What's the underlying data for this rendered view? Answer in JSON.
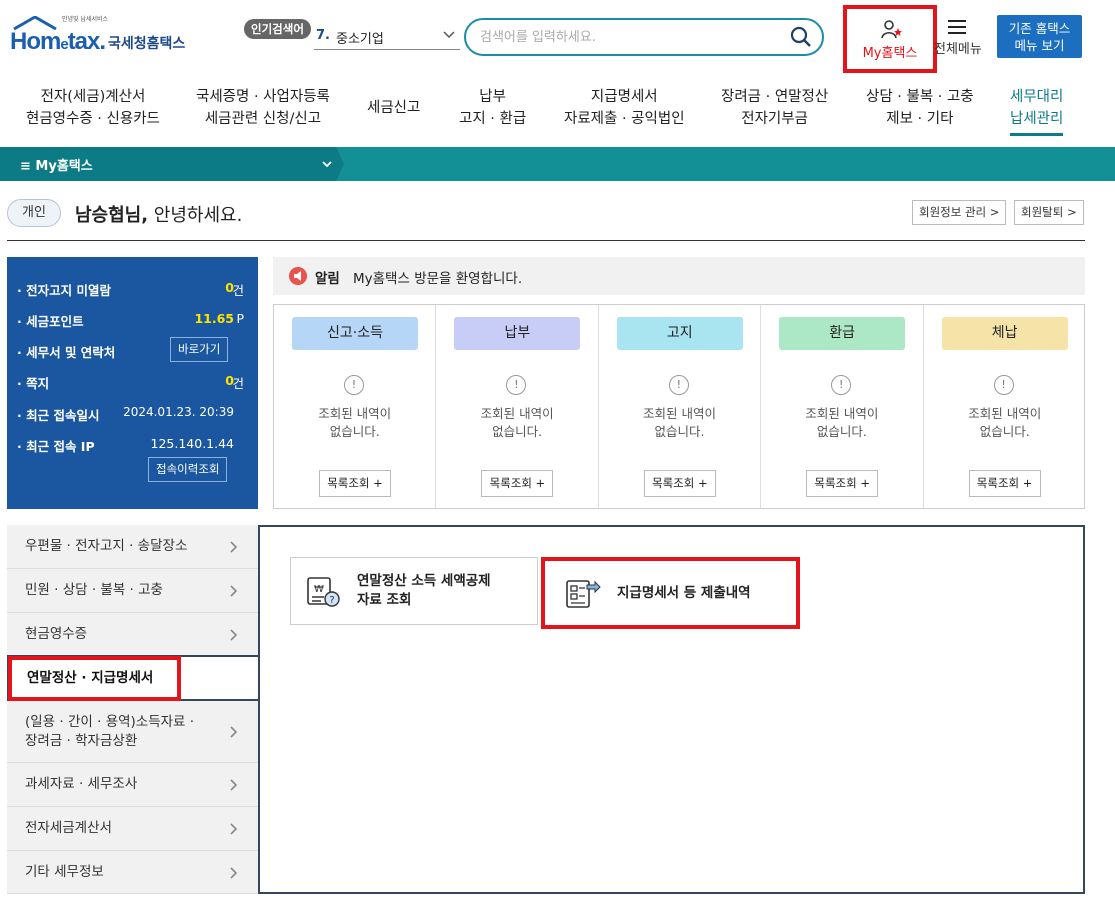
{
  "header": {
    "logo_tagline": "안녕및 납세서비스",
    "logo_home": "Hom",
    "logo_e": "e",
    "logo_tax": "tax.",
    "logo_agency": "국세청홈택스",
    "popular_badge": "인기검색어",
    "popular_num": "7.",
    "popular_keyword": "중소기업",
    "search_placeholder": "검색어를 입력하세요.",
    "myhome_label": "My홈택스",
    "allmenu_label": "전체메뉴",
    "old_menu_line1": "기존 홈택스",
    "old_menu_line2": "메뉴 보기"
  },
  "nav": [
    {
      "line1": "전자(세금)계산서",
      "line2": "현금영수증 · 신용카드"
    },
    {
      "line1": "국세증명 · 사업자등록",
      "line2": "세금관련 신청/신고"
    },
    {
      "line1": "세금신고",
      "line2": ""
    },
    {
      "line1": "납부",
      "line2": "고지 · 환급"
    },
    {
      "line1": "지급명세서",
      "line2": "자료제출 · 공익법인"
    },
    {
      "line1": "장려금 · 연말정산",
      "line2": "전자기부금"
    },
    {
      "line1": "상담 · 불복 · 고충",
      "line2": "제보 · 기타"
    },
    {
      "line1": "세무대리",
      "line2": "납세관리"
    }
  ],
  "subbar": {
    "label": "≡  My홈택스"
  },
  "greeting": {
    "type_badge": "개인",
    "name": "남승협님,",
    "text": " 안녕하세요.",
    "btn_member_info": "회원정보 관리 >",
    "btn_withdraw": "회원탈퇴 >"
  },
  "info": {
    "unread_label": "· 전자고지 미열람",
    "unread_value": "0",
    "unread_unit": "건",
    "points_label": "· 세금포인트",
    "points_value": "11.65",
    "points_unit": "P",
    "office_label": "· 세무서 및 연락처",
    "office_btn": "바로가기",
    "note_label": "· 쪽지",
    "note_value": "0",
    "note_unit": "건",
    "last_login_label": "· 최근 접속일시",
    "last_login_value": "2024.01.23.  20:39",
    "last_ip_label": "· 최근 접속 IP",
    "last_ip_value": "125.140.1.44",
    "history_btn": "접속이력조회"
  },
  "alert": {
    "title": "알림",
    "message": "My홈택스 방문을 환영합니다."
  },
  "categories": [
    {
      "title": "신고·소득",
      "color": "#b5d6f7",
      "empty1": "조회된 내역이",
      "empty2": "없습니다.",
      "more": "목록조회 +"
    },
    {
      "title": "납부",
      "color": "#c7cdf6",
      "empty1": "조회된 내역이",
      "empty2": "없습니다.",
      "more": "목록조회 +"
    },
    {
      "title": "고지",
      "color": "#a9e4f1",
      "empty1": "조회된 내역이",
      "empty2": "없습니다.",
      "more": "목록조회 +"
    },
    {
      "title": "환급",
      "color": "#ace7c6",
      "empty1": "조회된 내역이",
      "empty2": "없습니다.",
      "more": "목록조회 +"
    },
    {
      "title": "체납",
      "color": "#f6e3a8",
      "empty1": "조회된 내역이",
      "empty2": "없습니다.",
      "more": "목록조회 +"
    }
  ],
  "side_menu": [
    {
      "line1": "우편물 · 전자고지 · 송달장소",
      "line2": ""
    },
    {
      "line1": "민원 · 상담 · 불복 · 고충",
      "line2": ""
    },
    {
      "line1": "현금영수증",
      "line2": ""
    },
    {
      "line1": "연말정산 · 지급명세서",
      "line2": ""
    },
    {
      "line1": "(일용 · 간이 · 용역)소득자료 ·",
      "line2": "장려금 · 학자금상환"
    },
    {
      "line1": "과세자료 · 세무조사",
      "line2": ""
    },
    {
      "line1": "전자세금계산서",
      "line2": ""
    },
    {
      "line1": "기타 세무정보",
      "line2": ""
    }
  ],
  "services": [
    {
      "line1": "연말정산 소득 세액공제",
      "line2": "자료 조회",
      "icon": "tax-deduction-doc-icon"
    },
    {
      "line1": "지급명세서 등 제출내역",
      "line2": "",
      "icon": "submission-doc-icon"
    }
  ],
  "colors": {
    "highlight": "#e3141c",
    "teal": "#138f96",
    "navy": "#1a57a0"
  }
}
